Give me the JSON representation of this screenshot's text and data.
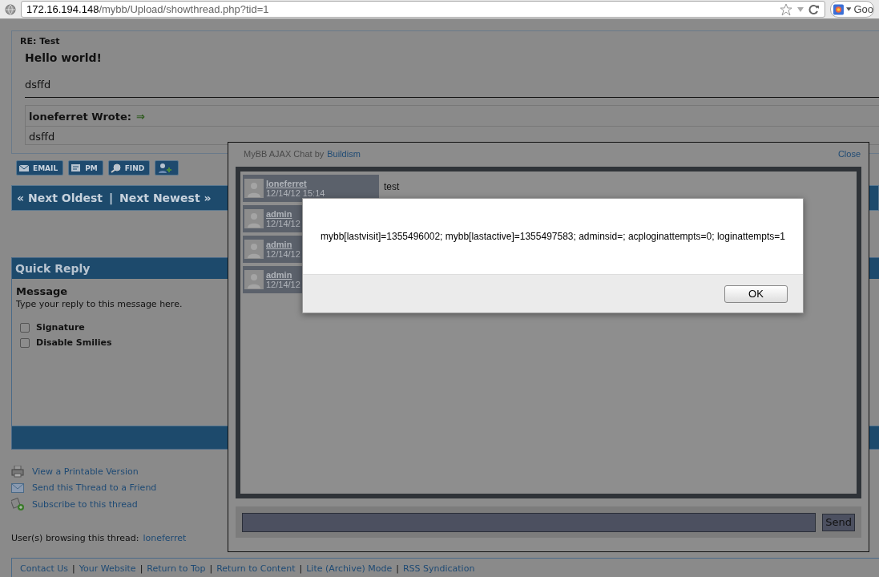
{
  "browser": {
    "url_host": "172.16.194.148",
    "url_path": "/mybb/Upload/showthread.php?tid=1",
    "search_cut": "Goo"
  },
  "post": {
    "subject": "RE: Test",
    "title": "Hello world!",
    "body": "dsffd",
    "quote": {
      "header": "loneferret Wrote:",
      "arrow": "⇒",
      "body": "dsffd"
    }
  },
  "post_buttons": [
    {
      "kind": "email",
      "label": "EMAIL"
    },
    {
      "kind": "pm",
      "label": "PM"
    },
    {
      "kind": "find",
      "label": "FIND"
    },
    {
      "kind": "add-buddy"
    }
  ],
  "thread_nav": {
    "prev": "« Next Oldest",
    "separator": "|",
    "next": "Next Newest »"
  },
  "quick_reply": {
    "title": "Quick Reply",
    "heading": "Message",
    "hint": "Type your reply to this message here.",
    "options": [
      {
        "label": "Signature",
        "checked": false
      },
      {
        "label": "Disable Smilies",
        "checked": false
      }
    ]
  },
  "tools": [
    {
      "kind": "print",
      "label": "View a Printable Version"
    },
    {
      "kind": "mail",
      "label": "Send this Thread to a Friend"
    },
    {
      "kind": "subscribe",
      "label": "Subscribe to this thread"
    }
  ],
  "browsing": {
    "label": "User(s) browsing this thread:",
    "users": [
      "loneferret"
    ]
  },
  "footer_separator": "|",
  "footer_links": [
    "Contact Us",
    "Your Website",
    "Return to Top",
    "Return to Content",
    "Lite (Archive) Mode",
    "RSS Syndication"
  ],
  "chat": {
    "title": "MyBB AJAX Chat by",
    "author": "Buildism",
    "close": "Close",
    "messages": [
      {
        "user": "loneferret",
        "time": "12/14/12 15:14",
        "text": "test"
      },
      {
        "user": "admin",
        "time": "12/14/12"
      },
      {
        "user": "admin",
        "time": "12/14/12"
      },
      {
        "user": "admin",
        "time": "12/14/12"
      }
    ],
    "send": "Send"
  },
  "alert": {
    "message": "mybb[lastvisit]=1355496002; mybb[lastactive]=1355497583; adminsid=; acploginattempts=0; loginattempts=1",
    "button": "OK"
  }
}
